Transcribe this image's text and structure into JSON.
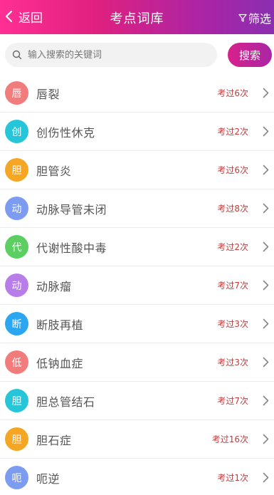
{
  "header": {
    "back_label": "返回",
    "title": "考点词库",
    "filter_label": "筛选"
  },
  "search": {
    "placeholder": "输入搜索的关键词",
    "value": "",
    "button_label": "搜索"
  },
  "items": [
    {
      "initial": "唇",
      "term": "唇裂",
      "count": "考过6次",
      "color": "#f27b7b"
    },
    {
      "initial": "创",
      "term": "创伤性休克",
      "count": "考过2次",
      "color": "#26c6da"
    },
    {
      "initial": "胆",
      "term": "胆管炎",
      "count": "考过6次",
      "color": "#f5a623"
    },
    {
      "initial": "动",
      "term": "动脉导管未闭",
      "count": "考过8次",
      "color": "#7c9cf2"
    },
    {
      "initial": "代",
      "term": "代谢性酸中毒",
      "count": "考过2次",
      "color": "#5ccf63"
    },
    {
      "initial": "动",
      "term": "动脉瘤",
      "count": "考过7次",
      "color": "#b77de8"
    },
    {
      "initial": "断",
      "term": "断肢再植",
      "count": "考过3次",
      "color": "#2ba6f0"
    },
    {
      "initial": "低",
      "term": "低钠血症",
      "count": "考过3次",
      "color": "#f27b7b"
    },
    {
      "initial": "胆",
      "term": "胆总管结石",
      "count": "考过7次",
      "color": "#26c6da"
    },
    {
      "initial": "胆",
      "term": "胆石症",
      "count": "考过16次",
      "color": "#f5a623"
    },
    {
      "initial": "呃",
      "term": "呃逆",
      "count": "考过1次",
      "color": "#7c9cf2"
    }
  ]
}
